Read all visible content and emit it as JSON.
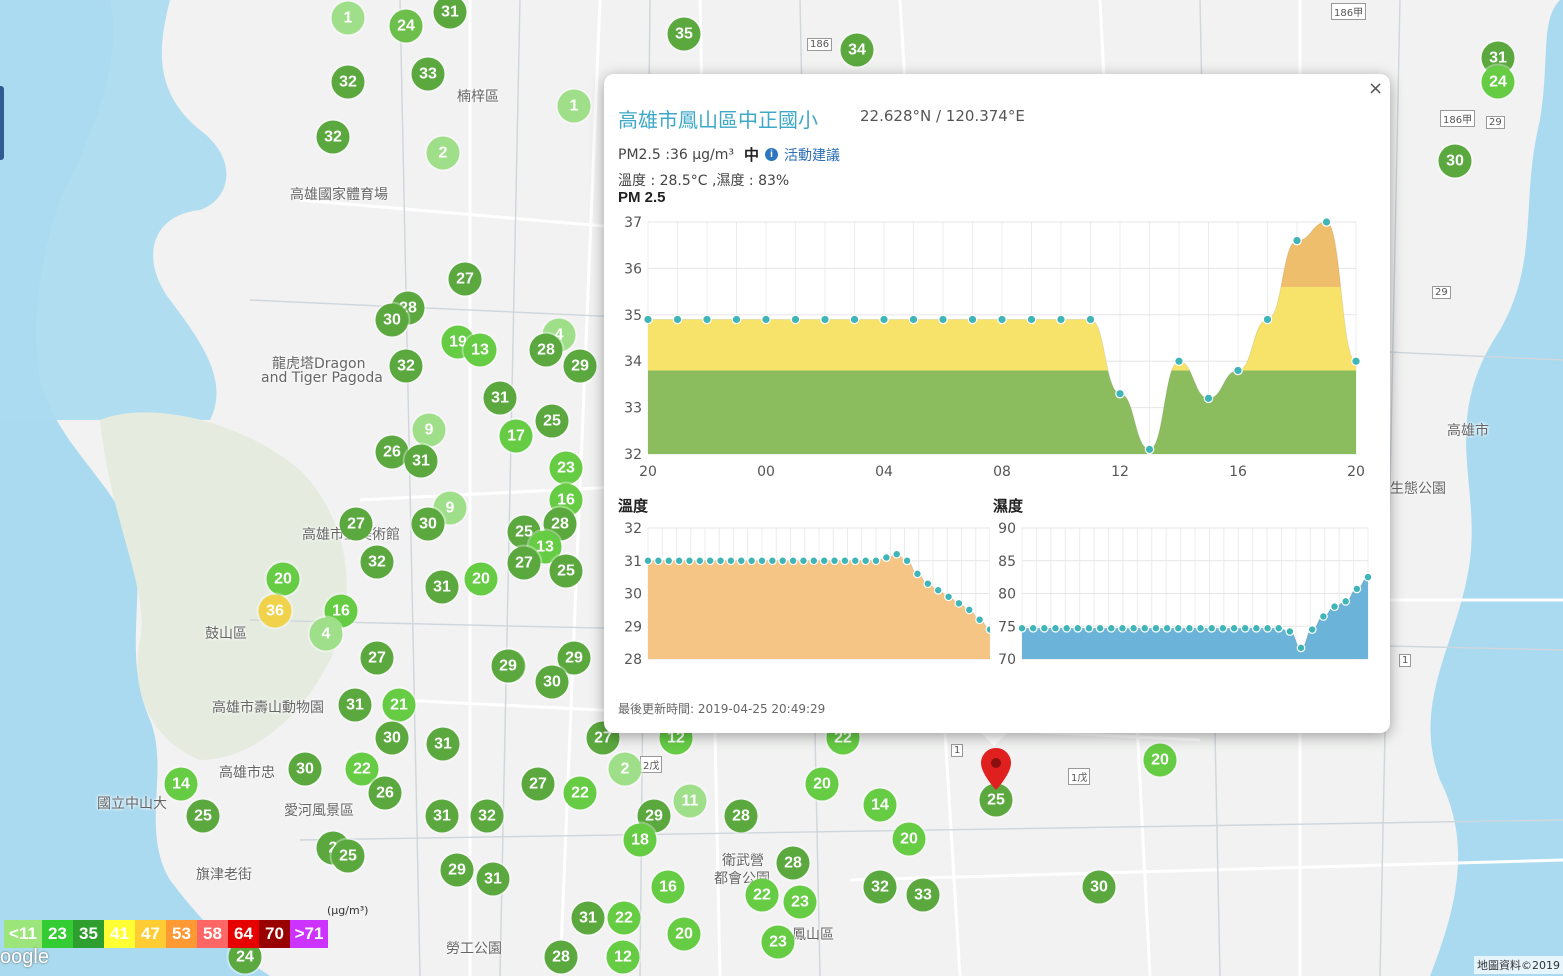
{
  "colors": {
    "water": "#aadaf0",
    "land": "#f1f1f1",
    "pm_green": "#8bbd5f",
    "pm_yellow": "#f7e36a",
    "pm_orange": "#efbe6c",
    "dot_teal": "#3fb5b8",
    "humidity_blue": "#6bb3d8",
    "temp_orange": "#f4c585",
    "link_blue": "#3ea8c7"
  },
  "map": {
    "labels": [
      {
        "text": "楠梓區"
      },
      {
        "text": "高雄國家體育場"
      },
      {
        "text": "龍虎塔Dragon"
      },
      {
        "text": "and Tiger Pagoda"
      },
      {
        "text": "鼓山區"
      },
      {
        "text": "高雄市壽山動物園"
      },
      {
        "text": "高雄市忠"
      },
      {
        "text": "國立中山大"
      },
      {
        "text": "愛河風景區"
      },
      {
        "text": "旗津老街"
      },
      {
        "text": "勞工公園"
      },
      {
        "text": "衛武營"
      },
      {
        "text": "都會公園"
      },
      {
        "text": "鳳山區"
      },
      {
        "text": "生態公園"
      },
      {
        "text": "高雄市"
      },
      {
        "text": "高雄市立美術館"
      }
    ],
    "markers": [
      {
        "v": "1",
        "c": "#9fdf8a"
      },
      {
        "v": "24",
        "c": "#6cbf4a"
      },
      {
        "v": "31",
        "c": "#5aa83e"
      },
      {
        "v": "33",
        "c": "#5aa83e"
      },
      {
        "v": "32",
        "c": "#5aa83e"
      },
      {
        "v": "32",
        "c": "#5aa83e"
      },
      {
        "v": "2",
        "c": "#9fdf8a"
      },
      {
        "v": "35",
        "c": "#5aa83e"
      },
      {
        "v": "34",
        "c": "#5aa83e"
      },
      {
        "v": "1",
        "c": "#9fdf8a"
      },
      {
        "v": "27",
        "c": "#5aa83e"
      },
      {
        "v": "28",
        "c": "#5aa83e"
      },
      {
        "v": "30",
        "c": "#5aa83e"
      },
      {
        "v": "19",
        "c": "#66cc44"
      },
      {
        "v": "13",
        "c": "#66cc44"
      },
      {
        "v": "32",
        "c": "#5aa83e"
      },
      {
        "v": "4",
        "c": "#9fdf8a"
      },
      {
        "v": "28",
        "c": "#5aa83e"
      },
      {
        "v": "29",
        "c": "#5aa83e"
      },
      {
        "v": "31",
        "c": "#5aa83e"
      },
      {
        "v": "9",
        "c": "#9fdf8a"
      },
      {
        "v": "17",
        "c": "#66cc44"
      },
      {
        "v": "25",
        "c": "#5aa83e"
      },
      {
        "v": "26",
        "c": "#5aa83e"
      },
      {
        "v": "31",
        "c": "#5aa83e"
      },
      {
        "v": "23",
        "c": "#66cc44"
      },
      {
        "v": "16",
        "c": "#66cc44"
      },
      {
        "v": "9",
        "c": "#9fdf8a"
      },
      {
        "v": "27",
        "c": "#5aa83e"
      },
      {
        "v": "30",
        "c": "#5aa83e"
      },
      {
        "v": "28",
        "c": "#5aa83e"
      },
      {
        "v": "25",
        "c": "#5aa83e"
      },
      {
        "v": "13",
        "c": "#66cc44"
      },
      {
        "v": "32",
        "c": "#5aa83e"
      },
      {
        "v": "31",
        "c": "#5aa83e"
      },
      {
        "v": "20",
        "c": "#66cc44"
      },
      {
        "v": "27",
        "c": "#5aa83e"
      },
      {
        "v": "25",
        "c": "#5aa83e"
      },
      {
        "v": "20",
        "c": "#66cc44"
      },
      {
        "v": "36",
        "c": "#f0d34a"
      },
      {
        "v": "16",
        "c": "#66cc44"
      },
      {
        "v": "4",
        "c": "#9fdf8a"
      },
      {
        "v": "27",
        "c": "#5aa83e"
      },
      {
        "v": "29",
        "c": "#5aa83e"
      },
      {
        "v": "29",
        "c": "#5aa83e"
      },
      {
        "v": "30",
        "c": "#5aa83e"
      },
      {
        "v": "31",
        "c": "#5aa83e"
      },
      {
        "v": "21",
        "c": "#66cc44"
      },
      {
        "v": "30",
        "c": "#5aa83e"
      },
      {
        "v": "31",
        "c": "#5aa83e"
      },
      {
        "v": "27",
        "c": "#5aa83e"
      },
      {
        "v": "12",
        "c": "#66cc44"
      },
      {
        "v": "22",
        "c": "#66cc44"
      },
      {
        "v": "30",
        "c": "#5aa83e"
      },
      {
        "v": "22",
        "c": "#66cc44"
      },
      {
        "v": "26",
        "c": "#5aa83e"
      },
      {
        "v": "14",
        "c": "#66cc44"
      },
      {
        "v": "25",
        "c": "#5aa83e"
      },
      {
        "v": "27",
        "c": "#5aa83e"
      },
      {
        "v": "22",
        "c": "#66cc44"
      },
      {
        "v": "2",
        "c": "#9fdf8a"
      },
      {
        "v": "11",
        "c": "#9fdf8a"
      },
      {
        "v": "29",
        "c": "#5aa83e"
      },
      {
        "v": "20",
        "c": "#66cc44"
      },
      {
        "v": "14",
        "c": "#66cc44"
      },
      {
        "v": "28",
        "c": "#5aa83e"
      },
      {
        "v": "20",
        "c": "#66cc44"
      },
      {
        "v": "31",
        "c": "#5aa83e"
      },
      {
        "v": "32",
        "c": "#5aa83e"
      },
      {
        "v": "29",
        "c": "#5aa83e"
      },
      {
        "v": "18",
        "c": "#66cc44"
      },
      {
        "v": "2",
        "c": "#5aa83e"
      },
      {
        "v": "25",
        "c": "#5aa83e"
      },
      {
        "v": "29",
        "c": "#5aa83e"
      },
      {
        "v": "31",
        "c": "#5aa83e"
      },
      {
        "v": "16",
        "c": "#66cc44"
      },
      {
        "v": "28",
        "c": "#5aa83e"
      },
      {
        "v": "22",
        "c": "#66cc44"
      },
      {
        "v": "23",
        "c": "#66cc44"
      },
      {
        "v": "32",
        "c": "#5aa83e"
      },
      {
        "v": "33",
        "c": "#5aa83e"
      },
      {
        "v": "30",
        "c": "#5aa83e"
      },
      {
        "v": "31",
        "c": "#5aa83e"
      },
      {
        "v": "22",
        "c": "#66cc44"
      },
      {
        "v": "20",
        "c": "#66cc44"
      },
      {
        "v": "23",
        "c": "#66cc44"
      },
      {
        "v": "28",
        "c": "#5aa83e"
      },
      {
        "v": "12",
        "c": "#66cc44"
      },
      {
        "v": "24",
        "c": "#5aa83e"
      },
      {
        "v": "31",
        "c": "#5aa83e"
      },
      {
        "v": "24",
        "c": "#66cc44"
      },
      {
        "v": "30",
        "c": "#5aa83e"
      },
      {
        "v": "20",
        "c": "#66cc44"
      },
      {
        "v": "25",
        "c": "#5aa83e"
      },
      {
        "v": "36",
        "c": "#f0d34a"
      }
    ],
    "road_badges": [
      "186甲",
      "186",
      "186甲",
      "29",
      "29",
      "1",
      "1戊",
      "1",
      "2戊"
    ]
  },
  "popup": {
    "close": "×",
    "site_name": "高雄市鳳山區中正國小",
    "coords": "22.628°N / 120.374°E",
    "pm_value": "PM2.5 :36 μg/m³",
    "pm_level": "中",
    "info_icon": "i",
    "advice_link": "活動建議",
    "temp_humidity": "溫度 : 28.5°C ,濕度 : 83%",
    "pm_title": "PM 2.5",
    "temp_title": "溫度",
    "hum_title": "濕度",
    "updated": "最後更新時間: 2019-04-25 20:49:29"
  },
  "chart_data": [
    {
      "type": "area",
      "title": "PM 2.5",
      "x_ticks": [
        "20",
        "00",
        "04",
        "08",
        "12",
        "16",
        "20"
      ],
      "y_ticks": [
        32,
        33,
        34,
        35,
        36,
        37
      ],
      "ylim": [
        32,
        37
      ],
      "grid": true,
      "values": [
        34.9,
        34.9,
        34.9,
        34.9,
        34.9,
        34.9,
        34.9,
        34.9,
        34.9,
        34.9,
        34.9,
        34.9,
        34.9,
        34.9,
        34.9,
        34.9,
        33.3,
        32.1,
        34.0,
        33.2,
        33.8,
        34.9,
        36.6,
        37.0,
        34.0
      ]
    },
    {
      "type": "area",
      "title": "溫度",
      "y_ticks": [
        28,
        29,
        30,
        31,
        32
      ],
      "ylim": [
        28,
        32
      ],
      "grid": true,
      "values": [
        31.0,
        31.0,
        31.0,
        31.0,
        31.0,
        31.0,
        31.0,
        31.0,
        31.0,
        31.0,
        31.0,
        31.0,
        31.0,
        31.0,
        31.0,
        31.0,
        31.0,
        31.0,
        31.0,
        31.0,
        31.0,
        31.0,
        31.0,
        31.1,
        31.2,
        31.0,
        30.6,
        30.3,
        30.1,
        29.9,
        29.7,
        29.5,
        29.2,
        28.9
      ]
    },
    {
      "type": "area",
      "title": "濕度",
      "y_ticks": [
        70,
        75,
        80,
        85,
        90
      ],
      "ylim": [
        70,
        90
      ],
      "grid": true,
      "values": [
        74.7,
        74.7,
        74.7,
        74.7,
        74.7,
        74.7,
        74.7,
        74.7,
        74.7,
        74.7,
        74.7,
        74.7,
        74.7,
        74.7,
        74.7,
        74.7,
        74.7,
        74.7,
        74.7,
        74.7,
        74.7,
        74.7,
        74.7,
        74.7,
        74.2,
        71.7,
        74.5,
        76.5,
        78.0,
        78.8,
        80.7,
        82.5
      ]
    }
  ],
  "legend": {
    "unit": "(μg/m³)",
    "items": [
      {
        "label": "<11",
        "color": "#9be57a"
      },
      {
        "label": "23",
        "color": "#33cc33"
      },
      {
        "label": "35",
        "color": "#2e9e2e"
      },
      {
        "label": "41",
        "color": "#ffff33"
      },
      {
        "label": "47",
        "color": "#ffcc33"
      },
      {
        "label": "53",
        "color": "#ff9933"
      },
      {
        "label": "58",
        "color": "#ff6666"
      },
      {
        "label": "64",
        "color": "#e60000"
      },
      {
        "label": "70",
        "color": "#990000"
      },
      {
        "label": ">71",
        "color": "#cc33ff"
      }
    ]
  },
  "attribution": "地圖資料©2019",
  "google": "oogle"
}
